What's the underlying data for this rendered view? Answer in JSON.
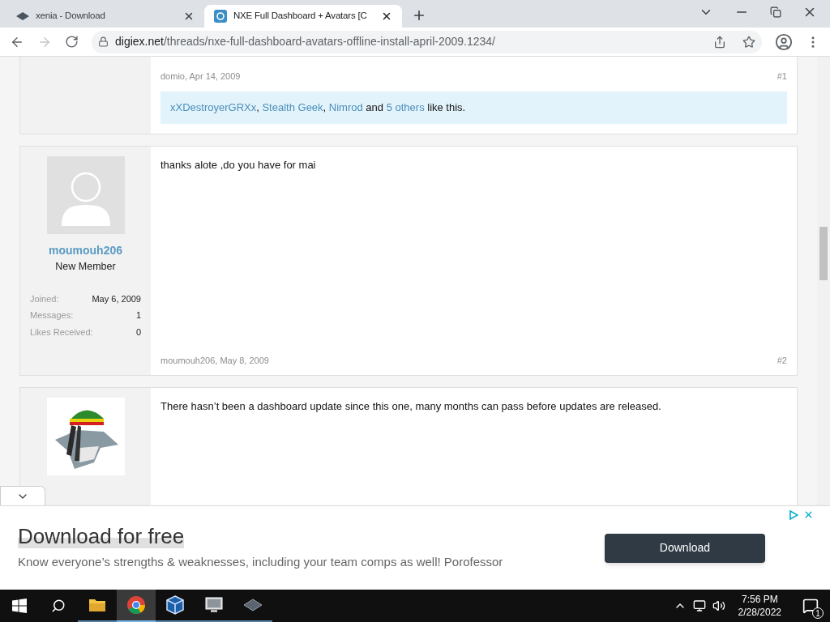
{
  "browser": {
    "tabs": [
      {
        "title": "xenia - Download",
        "selected": false
      },
      {
        "title": "NXE Full Dashboard + Avatars [C",
        "selected": true
      }
    ],
    "address": {
      "domain": "digiex.net",
      "path": "/threads/nxe-full-dashboard-avatars-offline-install-april-2009.1234/"
    },
    "forward_disabled": true
  },
  "posts": [
    {
      "byline": "domio, Apr 14, 2009",
      "number": "#1",
      "likes": [
        {
          "kind": "link",
          "text": "xXDestroyerGRXx"
        },
        {
          "kind": "text",
          "text": ", "
        },
        {
          "kind": "link",
          "text": "Stealth Geek"
        },
        {
          "kind": "text",
          "text": ", "
        },
        {
          "kind": "link",
          "text": "Nimrod"
        },
        {
          "kind": "text",
          "text": " and "
        },
        {
          "kind": "link",
          "text": "5 others"
        },
        {
          "kind": "text",
          "text": " like this."
        }
      ]
    },
    {
      "avatar": {
        "kind": "default"
      },
      "username": "moumouh206",
      "user_title": "New Member",
      "stats": [
        {
          "label": "Joined:",
          "value": "May 6, 2009"
        },
        {
          "label": "Messages:",
          "value": "1"
        },
        {
          "label": "Likes Received:",
          "value": "0"
        }
      ],
      "message": "thanks alote ,do you have for mai",
      "byline": "moumouh206, May 8, 2009",
      "number": "#2"
    },
    {
      "message": "There hasn’t been a dashboard update since this one, many months can pass before updates are released."
    }
  ],
  "ad": {
    "title": "Download for free",
    "text": "Know everyone’s strengths & weaknesses, including your team comps as well! Porofessor",
    "button": "Download"
  },
  "taskbar": {
    "apps": [
      {
        "kind": "folder",
        "selected": false
      },
      {
        "kind": "chrome",
        "selected": true
      },
      {
        "kind": "cube",
        "selected": false
      },
      {
        "kind": "monitor",
        "selected": false
      },
      {
        "kind": "emulator",
        "selected": false
      }
    ],
    "time": "7:56 PM",
    "date": "2/28/2022",
    "notifications": "1"
  }
}
